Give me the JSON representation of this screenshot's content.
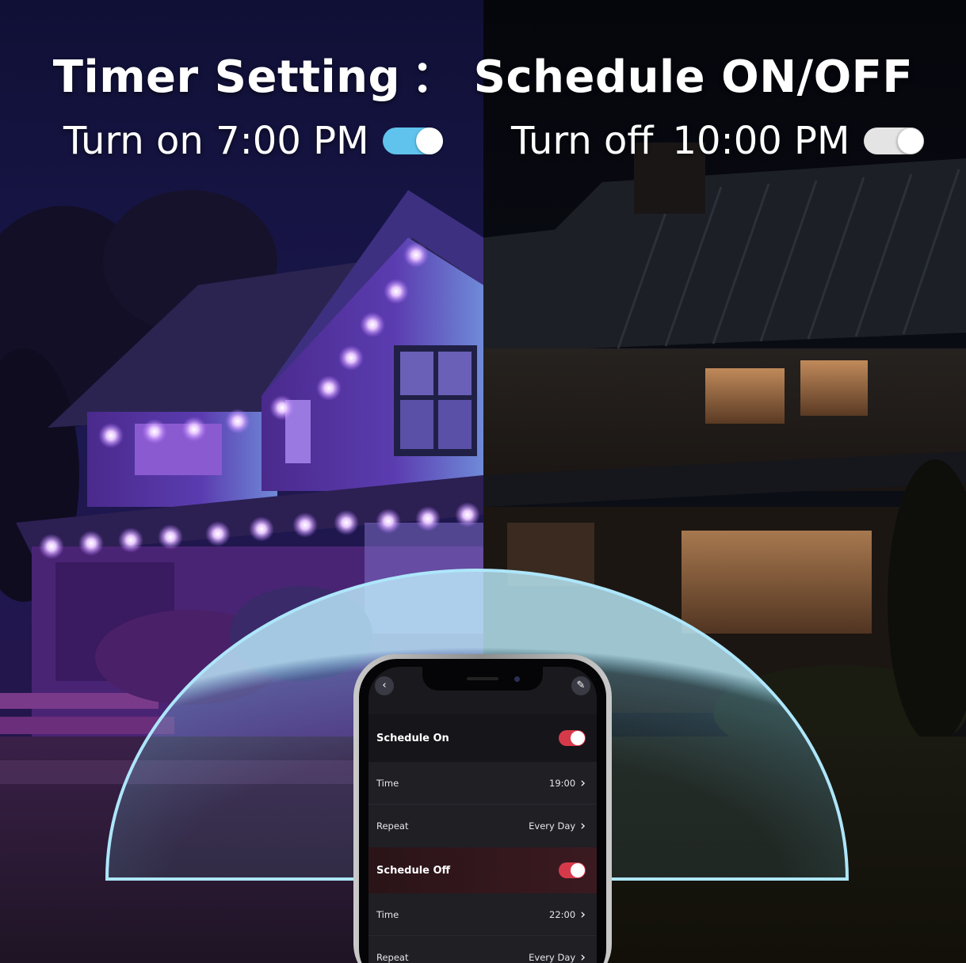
{
  "headline": {
    "left": "Timer Setting",
    "separator": "：",
    "right": "Schedule ON/OFF"
  },
  "timer_on": {
    "label": "Turn on 7:00 PM",
    "toggle_state": "on",
    "toggle_color": "#5fc3ee"
  },
  "timer_off": {
    "label_turn": "Turn off",
    "label_time": "10:00 PM",
    "toggle_state": "off",
    "toggle_color": "#e4e4e4"
  },
  "app": {
    "back_icon": "chevron-left-icon",
    "edit_icon": "pencil-icon",
    "schedule_on": {
      "title": "Schedule On",
      "enabled": true,
      "time_label": "Time",
      "time_value": "19:00",
      "repeat_label": "Repeat",
      "repeat_value": "Every Day"
    },
    "schedule_off": {
      "title": "Schedule Off",
      "enabled": true,
      "time_label": "Time",
      "time_value": "22:00",
      "repeat_label": "Repeat",
      "repeat_value": "Every Day"
    },
    "toggle_color": "#d63a4a"
  },
  "colors": {
    "lit_light": "#c98bff",
    "dome": "#7fd6f5"
  }
}
